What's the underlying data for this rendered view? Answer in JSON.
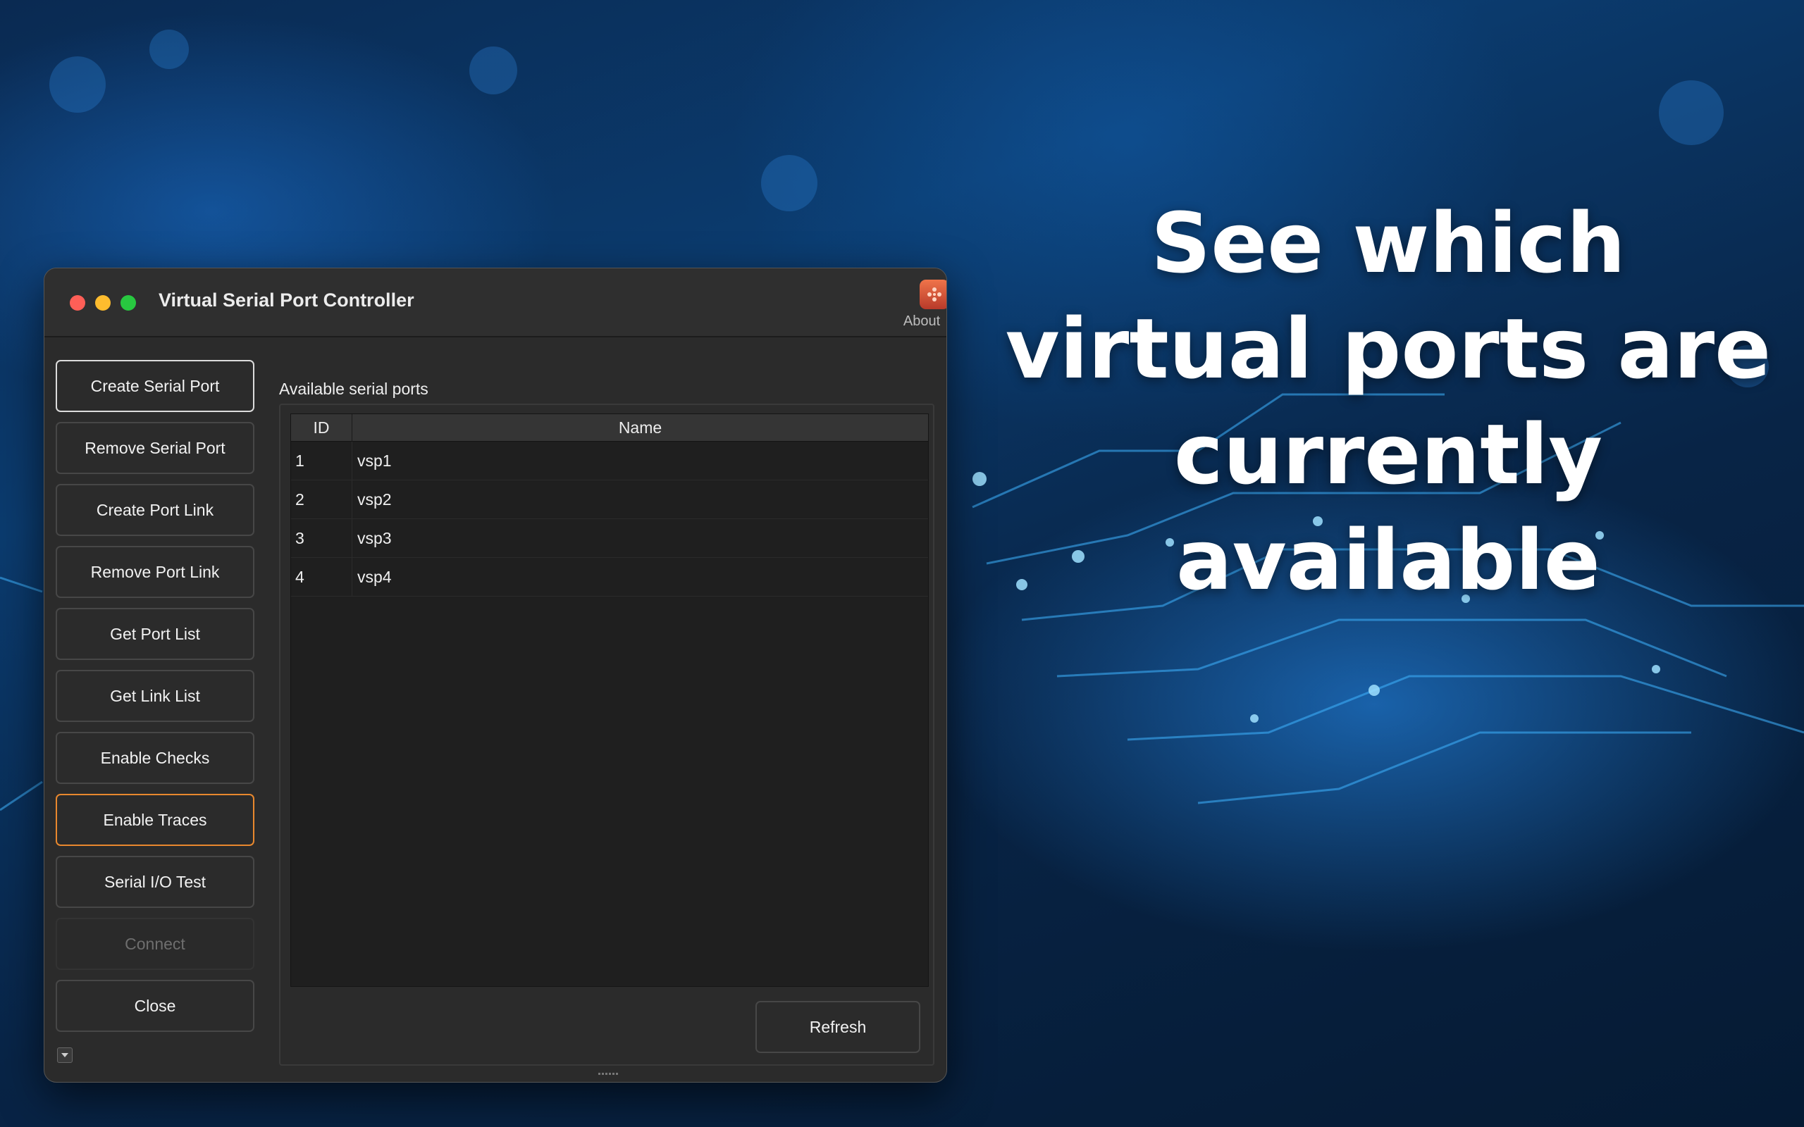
{
  "headline": "See which virtual ports are currently available",
  "window": {
    "title": "Virtual Serial Port Controller",
    "about_label": "About"
  },
  "sidebar": {
    "buttons": [
      {
        "label": "Create Serial Port",
        "state": "focused"
      },
      {
        "label": "Remove Serial Port",
        "state": "normal"
      },
      {
        "label": "Create Port Link",
        "state": "normal"
      },
      {
        "label": "Remove Port Link",
        "state": "normal"
      },
      {
        "label": "Get Port List",
        "state": "normal"
      },
      {
        "label": "Get Link List",
        "state": "normal"
      },
      {
        "label": "Enable Checks",
        "state": "normal"
      },
      {
        "label": "Enable Traces",
        "state": "highlighted"
      },
      {
        "label": "Serial I/O Test",
        "state": "normal"
      },
      {
        "label": "Connect",
        "state": "disabled"
      },
      {
        "label": "Close",
        "state": "normal"
      }
    ]
  },
  "panel": {
    "label": "Available serial ports",
    "columns": [
      "ID",
      "Name"
    ],
    "rows": [
      {
        "id": "1",
        "name": "vsp1"
      },
      {
        "id": "2",
        "name": "vsp2"
      },
      {
        "id": "3",
        "name": "vsp3"
      },
      {
        "id": "4",
        "name": "vsp4"
      }
    ],
    "refresh_label": "Refresh"
  },
  "icons": {
    "app_icon": "app-logo-icon",
    "collapse": "chevron-down-icon"
  },
  "colors": {
    "highlight_border": "#e8882e",
    "close_dot": "#ff5f57",
    "minimize_dot": "#febc2e",
    "maximize_dot": "#28c840"
  }
}
